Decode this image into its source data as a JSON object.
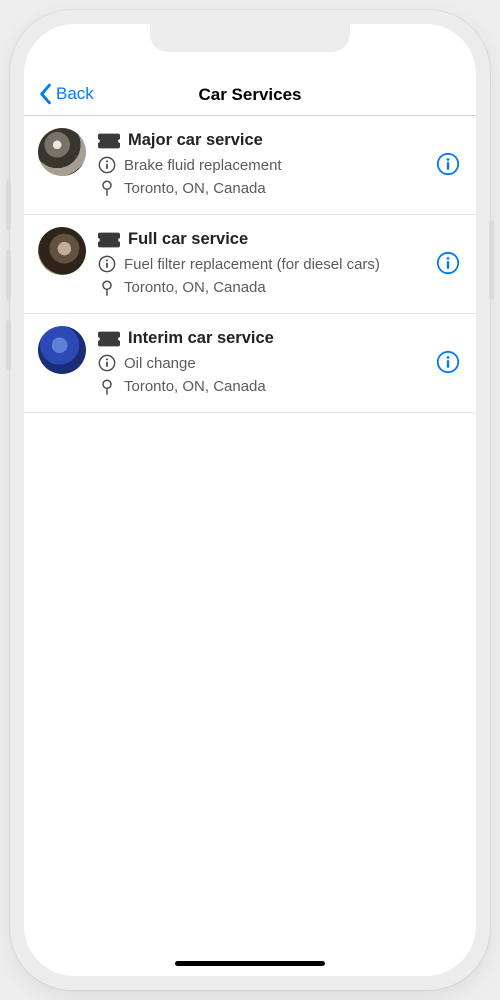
{
  "colors": {
    "accent": "#007aff"
  },
  "nav": {
    "back_label": "Back",
    "title": "Car Services"
  },
  "services": [
    {
      "title": "Major car service",
      "detail": "Brake fluid replacement",
      "location": "Toronto, ON, Canada"
    },
    {
      "title": "Full car service",
      "detail": "Fuel filter replacement (for diesel cars)",
      "location": "Toronto, ON, Canada"
    },
    {
      "title": "Interim car service",
      "detail": "Oil change",
      "location": "Toronto, ON, Canada"
    }
  ]
}
